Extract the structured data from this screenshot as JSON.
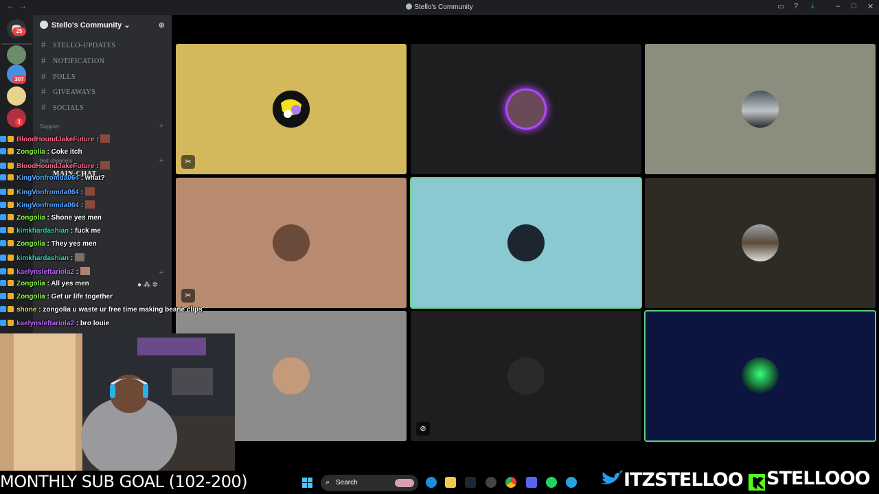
{
  "window": {
    "title": "Stello's Community"
  },
  "guild_badges": [
    "25",
    "307",
    "1"
  ],
  "server": {
    "name": "Stello's Community"
  },
  "channels": [
    "STELLO-UPDATES",
    "NOTIFICATION",
    "POLLS",
    "GIVEAWAYS",
    "SOCIALS"
  ],
  "overlapped_sidebar": {
    "category_support": "Support",
    "category_text": "text channels",
    "main_chat": "MAIN-CHAT"
  },
  "voice_tiles": [
    {
      "color": "#d3b95c",
      "muted": true
    },
    {
      "color": "#1e1d1f",
      "muted": false,
      "speaking": true
    },
    {
      "color": "#8b8e7d",
      "muted": false
    },
    {
      "color": "#b88a70",
      "muted": true
    },
    {
      "color": "#8ac8d2",
      "muted": false,
      "focused": true
    },
    {
      "color": "#2e2a24",
      "muted": false
    },
    {
      "color": "#8d8c8a",
      "muted": false
    },
    {
      "color": "#1e1d1f",
      "muted": false,
      "camera_off": true
    },
    {
      "color": "#0b1540",
      "muted": false,
      "focused": true
    }
  ],
  "chat": [
    {
      "user": "BloodHoundJakeFuture",
      "color": "#ff6b8b",
      "text": " :",
      "emote": true
    },
    {
      "user": "Zongolia",
      "color": "#8cff4a",
      "text": " : Coke itch"
    },
    {
      "user": "BloodHoundJakeFuture",
      "color": "#ff6b8b",
      "text": " :",
      "emote": true
    },
    {
      "user": "KingVonfromda064",
      "color": "#5aa8ff",
      "text": " : what?"
    },
    {
      "user": "KingVonfromda064",
      "color": "#5aa8ff",
      "text": " :",
      "emote": true
    },
    {
      "user": "KingVonfromda064",
      "color": "#5aa8ff",
      "text": " :",
      "emote": true
    },
    {
      "user": "Zongolia",
      "color": "#8cff4a",
      "text": " : Shone yes men"
    },
    {
      "user": "kimkhardashian",
      "color": "#3cd2b4",
      "text": " : fuck me"
    },
    {
      "user": "Zongolia",
      "color": "#8cff4a",
      "text": " : They yes men"
    },
    {
      "user": "kimkhardashian",
      "color": "#3cd2b4",
      "text": " :",
      "emote": true
    },
    {
      "user": "kaelynsleftariola2",
      "color": "#c064ff",
      "text": " :",
      "emote": true
    },
    {
      "user": "Zongolia",
      "color": "#8cff4a",
      "text": " : All yes men"
    },
    {
      "user": "Zongolia",
      "color": "#8cff4a",
      "text": " : Get ur life together"
    },
    {
      "user": "shone",
      "color": "#ffd84a",
      "text": " : zongolia u waste ur free time making beane clips"
    },
    {
      "user": "kaelynsleftariola2",
      "color": "#c064ff",
      "text": " : bro louie"
    }
  ],
  "stream": {
    "goal": "MONTHLY SUB GOAL (102-200)",
    "twitter": "ITZSTELLOO",
    "kick": "STELLOOO"
  },
  "taskbar": {
    "search_placeholder": "Search"
  }
}
